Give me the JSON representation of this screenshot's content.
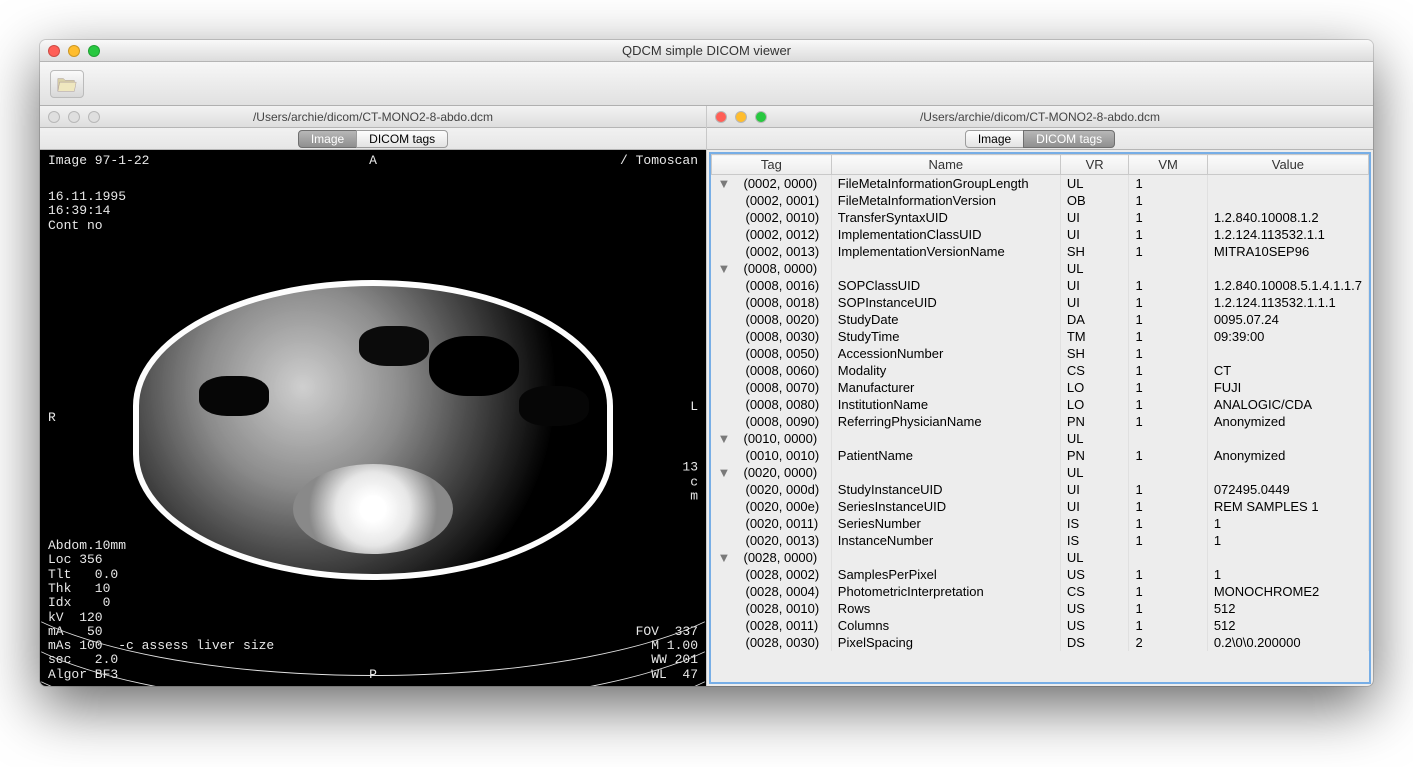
{
  "window": {
    "title": "QDCM simple DICOM viewer"
  },
  "tabs": {
    "image": "Image",
    "dicom": "DICOM tags"
  },
  "leftPane": {
    "title": "/Users/archie/dicom/CT-MONO2-8-abdo.dcm",
    "overlay": {
      "topLeft": "Image 97-1-22",
      "topCenter": "A",
      "topRight": "/ Tomoscan",
      "dateBlock": "16.11.1995\n16:39:14\nCont no",
      "midLeft": "R",
      "midRight": "L",
      "midRightStack": "13\nc\nm",
      "bottomLeft": "Abdom.10mm\nLoc 356\nTlt   0.0\nThk   10\nIdx    0\nkV  120\nmA   50\nmAs 100  -c assess liver size\nsec   2.0\nAlgor BF3",
      "bottomCenter": "P",
      "bottomRight": "FOV  337\nM 1.00\nWW 201\nWL  47"
    }
  },
  "rightPane": {
    "title": "/Users/archie/dicom/CT-MONO2-8-abdo.dcm",
    "headers": {
      "tag": "Tag",
      "name": "Name",
      "vr": "VR",
      "vm": "VM",
      "value": "Value"
    },
    "rows": [
      {
        "level": 0,
        "expand": true,
        "tag": "(0002, 0000)",
        "name": "FileMetaInformationGroupLength",
        "vr": "UL",
        "vm": "1",
        "value": ""
      },
      {
        "level": 1,
        "tag": "(0002, 0001)",
        "name": "FileMetaInformationVersion",
        "vr": "OB",
        "vm": "1",
        "value": ""
      },
      {
        "level": 1,
        "tag": "(0002, 0010)",
        "name": "TransferSyntaxUID",
        "vr": "UI",
        "vm": "1",
        "value": "1.2.840.10008.1.2"
      },
      {
        "level": 1,
        "tag": "(0002, 0012)",
        "name": "ImplementationClassUID",
        "vr": "UI",
        "vm": "1",
        "value": "1.2.124.113532.1.1"
      },
      {
        "level": 1,
        "tag": "(0002, 0013)",
        "name": "ImplementationVersionName",
        "vr": "SH",
        "vm": "1",
        "value": "MITRA10SEP96"
      },
      {
        "level": 0,
        "expand": true,
        "tag": "(0008, 0000)",
        "name": "",
        "vr": "UL",
        "vm": "",
        "value": ""
      },
      {
        "level": 1,
        "tag": "(0008, 0016)",
        "name": "SOPClassUID",
        "vr": "UI",
        "vm": "1",
        "value": "1.2.840.10008.5.1.4.1.1.7"
      },
      {
        "level": 1,
        "tag": "(0008, 0018)",
        "name": "SOPInstanceUID",
        "vr": "UI",
        "vm": "1",
        "value": "1.2.124.113532.1.1.1"
      },
      {
        "level": 1,
        "tag": "(0008, 0020)",
        "name": "StudyDate",
        "vr": "DA",
        "vm": "1",
        "value": "0095.07.24"
      },
      {
        "level": 1,
        "tag": "(0008, 0030)",
        "name": "StudyTime",
        "vr": "TM",
        "vm": "1",
        "value": "09:39:00"
      },
      {
        "level": 1,
        "tag": "(0008, 0050)",
        "name": "AccessionNumber",
        "vr": "SH",
        "vm": "1",
        "value": ""
      },
      {
        "level": 1,
        "tag": "(0008, 0060)",
        "name": "Modality",
        "vr": "CS",
        "vm": "1",
        "value": "CT"
      },
      {
        "level": 1,
        "tag": "(0008, 0070)",
        "name": "Manufacturer",
        "vr": "LO",
        "vm": "1",
        "value": "FUJI"
      },
      {
        "level": 1,
        "tag": "(0008, 0080)",
        "name": "InstitutionName",
        "vr": "LO",
        "vm": "1",
        "value": "ANALOGIC/CDA"
      },
      {
        "level": 1,
        "tag": "(0008, 0090)",
        "name": "ReferringPhysicianName",
        "vr": "PN",
        "vm": "1",
        "value": "Anonymized"
      },
      {
        "level": 0,
        "expand": true,
        "tag": "(0010, 0000)",
        "name": "",
        "vr": "UL",
        "vm": "",
        "value": ""
      },
      {
        "level": 1,
        "tag": "(0010, 0010)",
        "name": "PatientName",
        "vr": "PN",
        "vm": "1",
        "value": "Anonymized"
      },
      {
        "level": 0,
        "expand": true,
        "tag": "(0020, 0000)",
        "name": "",
        "vr": "UL",
        "vm": "",
        "value": ""
      },
      {
        "level": 1,
        "tag": "(0020, 000d)",
        "name": "StudyInstanceUID",
        "vr": "UI",
        "vm": "1",
        "value": "072495.0449"
      },
      {
        "level": 1,
        "tag": "(0020, 000e)",
        "name": "SeriesInstanceUID",
        "vr": "UI",
        "vm": "1",
        "value": "REM SAMPLES 1"
      },
      {
        "level": 1,
        "tag": "(0020, 0011)",
        "name": "SeriesNumber",
        "vr": "IS",
        "vm": "1",
        "value": "1"
      },
      {
        "level": 1,
        "tag": "(0020, 0013)",
        "name": "InstanceNumber",
        "vr": "IS",
        "vm": "1",
        "value": "1"
      },
      {
        "level": 0,
        "expand": true,
        "tag": "(0028, 0000)",
        "name": "",
        "vr": "UL",
        "vm": "",
        "value": ""
      },
      {
        "level": 1,
        "tag": "(0028, 0002)",
        "name": "SamplesPerPixel",
        "vr": "US",
        "vm": "1",
        "value": "1"
      },
      {
        "level": 1,
        "tag": "(0028, 0004)",
        "name": "PhotometricInterpretation",
        "vr": "CS",
        "vm": "1",
        "value": "MONOCHROME2"
      },
      {
        "level": 1,
        "tag": "(0028, 0010)",
        "name": "Rows",
        "vr": "US",
        "vm": "1",
        "value": "512"
      },
      {
        "level": 1,
        "tag": "(0028, 0011)",
        "name": "Columns",
        "vr": "US",
        "vm": "1",
        "value": "512"
      },
      {
        "level": 1,
        "tag": "(0028, 0030)",
        "name": "PixelSpacing",
        "vr": "DS",
        "vm": "2",
        "value": "0.2\\0\\0.200000"
      }
    ]
  }
}
